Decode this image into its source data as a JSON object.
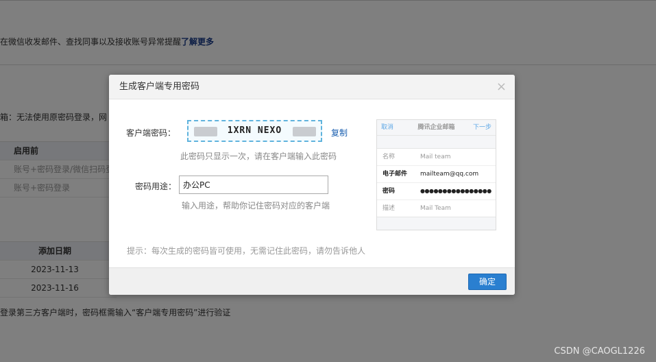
{
  "background": {
    "notice_text": "在微信收发邮件、查找同事以及接收账号异常提醒",
    "notice_link": "了解更多",
    "warning_text": "箱：无法使用原密码登录，网",
    "table1": {
      "header": "启用前",
      "rows": [
        "账号+密码登录/微信扫码登",
        "账号+密码登录"
      ]
    },
    "table2": {
      "header": "添加日期",
      "rows": [
        "2023-11-13",
        "2023-11-16"
      ]
    },
    "footer_text": "登录第三方客户端时，密码框需输入“客户端专用密码”进行验证"
  },
  "modal": {
    "title": "生成客户端专用密码",
    "close_symbol": "×",
    "client_password_label": "客户端密码：",
    "client_password_value": "1XRN NEXO",
    "copy_label": "复制",
    "password_hint": "此密码只显示一次，请在客户端输入此密码",
    "usage_label": "密码用途：",
    "usage_value": "办公PC",
    "usage_hint": "输入用途，帮助你记住密码对应的客户端",
    "tip": "提示：每次生成的密码皆可使用，无需记住此密码，请勿告诉他人",
    "ok_label": "确定"
  },
  "preview": {
    "cancel": "取消",
    "title": "腾讯企业邮箱",
    "next": "下一步",
    "rows": [
      {
        "key": "名称",
        "value": "Mail team"
      },
      {
        "key": "电子邮件",
        "value": "mailteam@qq.com"
      },
      {
        "key": "密码",
        "value": "●●●●●●●●●●●●●●●●"
      },
      {
        "key": "描述",
        "value": "Mail Team"
      }
    ]
  },
  "watermark": "CSDN @CAOGL1226"
}
